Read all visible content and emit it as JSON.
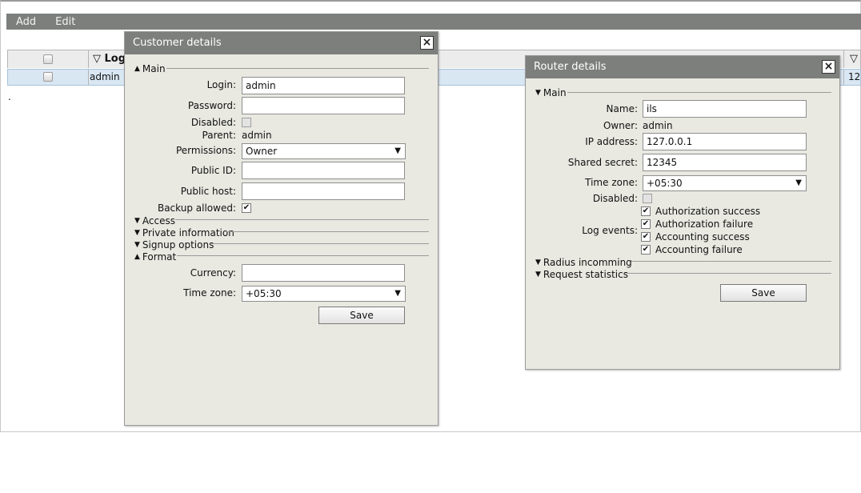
{
  "menubar": {
    "items": [
      "Add",
      "Edit"
    ]
  },
  "grid": {
    "headers": [
      "▽ Log",
      "▽"
    ],
    "row": {
      "login": "admin",
      "right_cut": "12"
    }
  },
  "customer_dialog": {
    "title": "Customer details",
    "close": "×",
    "sections": {
      "main": "Main",
      "access": "Access",
      "private": "Private information",
      "signup": "Signup options",
      "format": "Format"
    },
    "fields": {
      "login_label": "Login:",
      "login_value": "admin",
      "password_label": "Password:",
      "password_value": "",
      "disabled_label": "Disabled:",
      "parent_label": "Parent:",
      "parent_value": "admin",
      "permissions_label": "Permissions:",
      "permissions_value": "Owner",
      "public_id_label": "Public ID:",
      "public_id_value": "",
      "public_host_label": "Public host:",
      "public_host_value": "",
      "backup_label": "Backup allowed:",
      "backup_checked": "✔",
      "currency_label": "Currency:",
      "currency_value": "",
      "timezone_label": "Time zone:",
      "timezone_value": "+05:30"
    },
    "save_label": "Save"
  },
  "router_dialog": {
    "title": "Router details",
    "close": "×",
    "sections": {
      "main": "Main",
      "radius": "Radius incomming",
      "stats": "Request statistics"
    },
    "fields": {
      "name_label": "Name:",
      "name_value": "ils",
      "owner_label": "Owner:",
      "owner_value": "admin",
      "ip_label": "IP address:",
      "ip_value": "127.0.0.1",
      "secret_label": "Shared secret:",
      "secret_value": "12345",
      "timezone_label": "Time zone:",
      "timezone_value": "+05:30",
      "disabled_label": "Disabled:",
      "log_events_label": "Log events:",
      "log_events": [
        {
          "label": "Authorization success",
          "mark": "✔"
        },
        {
          "label": "Authorization failure",
          "mark": "✔"
        },
        {
          "label": "Accounting success",
          "mark": "✔"
        },
        {
          "label": "Accounting failure",
          "mark": "✔"
        }
      ]
    },
    "save_label": "Save"
  }
}
